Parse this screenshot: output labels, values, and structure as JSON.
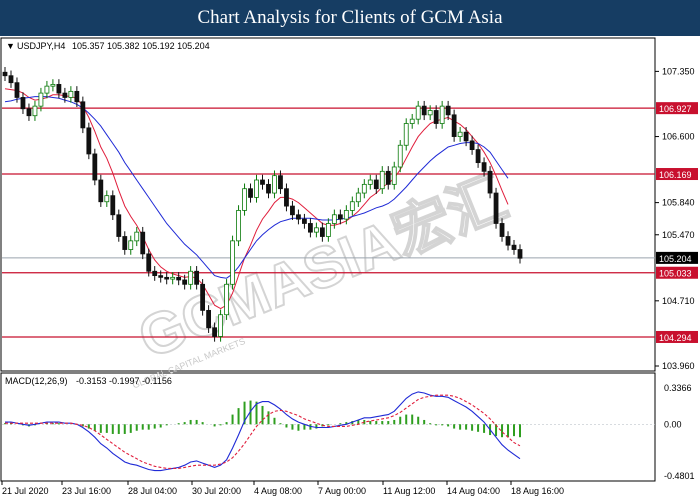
{
  "page_title": "Chart Analysis for Clients of GCM Asia",
  "watermark": "GCMASIA宏汇",
  "watermark_sub": "GLOBAL CAPITAL MARKETS",
  "colors": {
    "title_bg": "#163d63",
    "candle_up": "#0a7a0a",
    "candle_down": "#111111",
    "ma_fast": "#e01e3c",
    "ma_slow": "#1f2ad6",
    "level_line": "#c8102e",
    "level_label_bg": "#c8102e",
    "current_label_bg": "#000000",
    "histogram": "#2e9e1f",
    "macd_line": "#1f2ad6",
    "signal_line": "#e01e3c"
  },
  "chart_data": [
    {
      "type": "candlestick",
      "header": {
        "symbol_text": "USDJPY,H4",
        "ohlc_text": "105.357 105.382 105.192 105.204"
      },
      "symbol": "USDJPY",
      "timeframe": "H4",
      "ohlc": {
        "open": 105.357,
        "high": 105.382,
        "low": 105.192,
        "close": 105.204
      },
      "y_ticks": [
        "107.350",
        "106.600",
        "105.840",
        "105.470",
        "104.710",
        "103.960"
      ],
      "ylim": [
        103.96,
        107.55
      ],
      "x_ticks": [
        "21 Jul 2020",
        "23 Jul 16:00",
        "28 Jul 04:00",
        "30 Jul 20:00",
        "4 Aug 08:00",
        "7 Aug 00:00",
        "11 Aug 12:00",
        "14 Aug 04:00",
        "18 Aug 16:00"
      ],
      "levels": [
        {
          "value": 106.927,
          "label": "106.927"
        },
        {
          "value": 106.169,
          "label": "106.169"
        },
        {
          "value": 105.033,
          "label": "105.033"
        },
        {
          "value": 104.294,
          "label": "104.294"
        }
      ],
      "current_price": {
        "value": 105.204,
        "label": "105.204"
      },
      "series": [
        {
          "name": "Close",
          "values": [
            107.3,
            107.22,
            107.05,
            106.92,
            106.84,
            106.95,
            107.1,
            107.18,
            107.2,
            107.1,
            107.05,
            107.12,
            107.0,
            106.7,
            106.4,
            106.1,
            105.85,
            105.92,
            105.7,
            105.45,
            105.3,
            105.4,
            105.5,
            105.25,
            105.05,
            105.0,
            104.98,
            104.96,
            104.98,
            104.95,
            104.9,
            105.05,
            104.9,
            104.6,
            104.4,
            104.3,
            104.55,
            104.9,
            105.4,
            105.75,
            106.0,
            105.9,
            106.1,
            106.05,
            105.95,
            106.15,
            106.0,
            105.8,
            105.7,
            105.65,
            105.6,
            105.5,
            105.55,
            105.45,
            105.6,
            105.7,
            105.65,
            105.75,
            105.85,
            105.95,
            106.05,
            106.1,
            106.0,
            106.2,
            106.05,
            106.25,
            106.5,
            106.75,
            106.8,
            106.95,
            106.85,
            106.9,
            106.75,
            106.95,
            106.85,
            106.6,
            106.65,
            106.55,
            106.45,
            106.3,
            106.2,
            105.95,
            105.6,
            105.45,
            105.35,
            105.3,
            105.2
          ]
        },
        {
          "name": "MA",
          "values": [
            107.15,
            107.14,
            107.13,
            107.1,
            107.05,
            107.02,
            107.03,
            107.05,
            107.08,
            107.08,
            107.07,
            107.06,
            107.04,
            106.95,
            106.82,
            106.66,
            106.48,
            106.35,
            106.18,
            105.98,
            105.8,
            105.68,
            105.58,
            105.45,
            105.3,
            105.18,
            105.1,
            105.05,
            105.02,
            105.0,
            104.98,
            104.99,
            104.97,
            104.9,
            104.78,
            104.66,
            104.62,
            104.66,
            104.8,
            105.0,
            105.2,
            105.35,
            105.52,
            105.65,
            105.74,
            105.84,
            105.9,
            105.9,
            105.88,
            105.84,
            105.78,
            105.72,
            105.66,
            105.6,
            105.58,
            105.58,
            105.6,
            105.63,
            105.68,
            105.74,
            105.82,
            105.9,
            105.95,
            106.02,
            106.06,
            106.12,
            106.22,
            106.35,
            106.48,
            106.6,
            106.68,
            106.75,
            106.78,
            106.8,
            106.82,
            106.78,
            106.74,
            106.68,
            106.6,
            106.52,
            106.42,
            106.3,
            106.15,
            105.98,
            105.82,
            null,
            null
          ]
        },
        {
          "name": "MA",
          "values": [
            107.0,
            107.01,
            107.03,
            107.04,
            107.05,
            107.06,
            107.06,
            107.06,
            107.05,
            107.04,
            107.02,
            107.0,
            106.97,
            106.93,
            106.87,
            106.8,
            106.72,
            106.62,
            106.52,
            106.42,
            106.3,
            106.2,
            106.1,
            106.0,
            105.9,
            105.8,
            105.7,
            105.6,
            105.52,
            105.44,
            105.36,
            105.3,
            105.24,
            105.16,
            105.08,
            105.0,
            104.98,
            104.97,
            105.02,
            105.1,
            105.2,
            105.3,
            105.4,
            105.47,
            105.53,
            105.58,
            105.62,
            105.64,
            105.66,
            105.66,
            105.66,
            105.66,
            105.65,
            105.64,
            105.64,
            105.64,
            105.65,
            105.66,
            105.68,
            105.7,
            105.72,
            105.75,
            105.78,
            105.8,
            105.83,
            105.88,
            105.95,
            106.02,
            106.1,
            106.18,
            106.25,
            106.32,
            106.38,
            106.43,
            106.48,
            106.5,
            106.52,
            106.53,
            106.53,
            106.52,
            106.48,
            106.42,
            106.32,
            106.22,
            106.12,
            null,
            null
          ]
        }
      ]
    },
    {
      "type": "bar+line",
      "header": {
        "indicator_text": "MACD(12,26,9)",
        "values_text": "-0.3153 -0.1997 -0.1156"
      },
      "indicator": "MACD(12,26,9)",
      "y_ticks": [
        "0.3366",
        "0.00",
        "-0.4801"
      ],
      "ylim": [
        -0.4801,
        0.3366
      ],
      "series": [
        {
          "name": "MACD",
          "values": [
            0.02,
            0.02,
            0.01,
            0.0,
            -0.01,
            0.0,
            0.01,
            0.02,
            0.02,
            0.02,
            0.01,
            0.01,
            0.0,
            -0.03,
            -0.07,
            -0.12,
            -0.18,
            -0.22,
            -0.27,
            -0.31,
            -0.35,
            -0.37,
            -0.38,
            -0.4,
            -0.42,
            -0.43,
            -0.43,
            -0.42,
            -0.41,
            -0.4,
            -0.38,
            -0.35,
            -0.34,
            -0.36,
            -0.38,
            -0.4,
            -0.38,
            -0.33,
            -0.22,
            -0.1,
            0.03,
            0.12,
            0.19,
            0.21,
            0.21,
            0.18,
            0.14,
            0.09,
            0.05,
            0.02,
            0.0,
            -0.02,
            -0.03,
            -0.03,
            -0.03,
            -0.02,
            -0.01,
            0.0,
            0.02,
            0.04,
            0.06,
            0.06,
            0.07,
            0.08,
            0.09,
            0.12,
            0.18,
            0.24,
            0.28,
            0.3,
            0.29,
            0.27,
            0.26,
            0.26,
            0.25,
            0.22,
            0.19,
            0.16,
            0.12,
            0.07,
            0.02,
            -0.05,
            -0.12,
            -0.19,
            -0.24,
            -0.28,
            -0.32
          ]
        },
        {
          "name": "Signal",
          "values": [
            0.01,
            0.01,
            0.01,
            0.01,
            0.01,
            0.01,
            0.01,
            0.01,
            0.01,
            0.01,
            0.01,
            0.01,
            0.0,
            -0.01,
            -0.03,
            -0.06,
            -0.1,
            -0.14,
            -0.18,
            -0.22,
            -0.26,
            -0.29,
            -0.32,
            -0.35,
            -0.37,
            -0.39,
            -0.4,
            -0.41,
            -0.41,
            -0.41,
            -0.4,
            -0.39,
            -0.38,
            -0.38,
            -0.38,
            -0.38,
            -0.37,
            -0.35,
            -0.31,
            -0.25,
            -0.18,
            -0.1,
            -0.02,
            0.04,
            0.09,
            0.12,
            0.13,
            0.12,
            0.1,
            0.08,
            0.05,
            0.03,
            0.01,
            -0.01,
            -0.02,
            -0.02,
            -0.02,
            -0.02,
            -0.01,
            0.0,
            0.02,
            0.03,
            0.04,
            0.05,
            0.06,
            0.08,
            0.11,
            0.15,
            0.19,
            0.23,
            0.25,
            0.26,
            0.27,
            0.27,
            0.27,
            0.26,
            0.24,
            0.21,
            0.18,
            0.14,
            0.1,
            0.05,
            -0.01,
            -0.07,
            -0.12,
            -0.17,
            -0.2
          ]
        },
        {
          "name": "Histogram",
          "values": [
            0.01,
            0.01,
            0.0,
            -0.01,
            -0.02,
            -0.01,
            0.0,
            0.01,
            0.01,
            0.01,
            0.0,
            0.0,
            0.0,
            -0.02,
            -0.04,
            -0.06,
            -0.08,
            -0.08,
            -0.09,
            -0.09,
            -0.09,
            -0.08,
            -0.06,
            -0.05,
            -0.05,
            -0.04,
            -0.03,
            -0.01,
            0.0,
            0.01,
            0.02,
            0.04,
            0.04,
            0.02,
            0.0,
            -0.02,
            -0.01,
            0.02,
            0.09,
            0.15,
            0.21,
            0.22,
            0.21,
            0.17,
            0.12,
            0.06,
            0.01,
            -0.03,
            -0.05,
            -0.06,
            -0.05,
            -0.05,
            -0.04,
            -0.02,
            -0.01,
            0.0,
            0.01,
            0.02,
            0.03,
            0.04,
            0.04,
            0.03,
            0.03,
            0.03,
            0.03,
            0.04,
            0.07,
            0.09,
            0.09,
            0.07,
            0.04,
            0.01,
            -0.01,
            -0.01,
            -0.02,
            -0.04,
            -0.05,
            -0.05,
            -0.06,
            -0.07,
            -0.08,
            -0.1,
            -0.11,
            -0.12,
            -0.12,
            -0.11,
            -0.12
          ]
        }
      ]
    }
  ]
}
